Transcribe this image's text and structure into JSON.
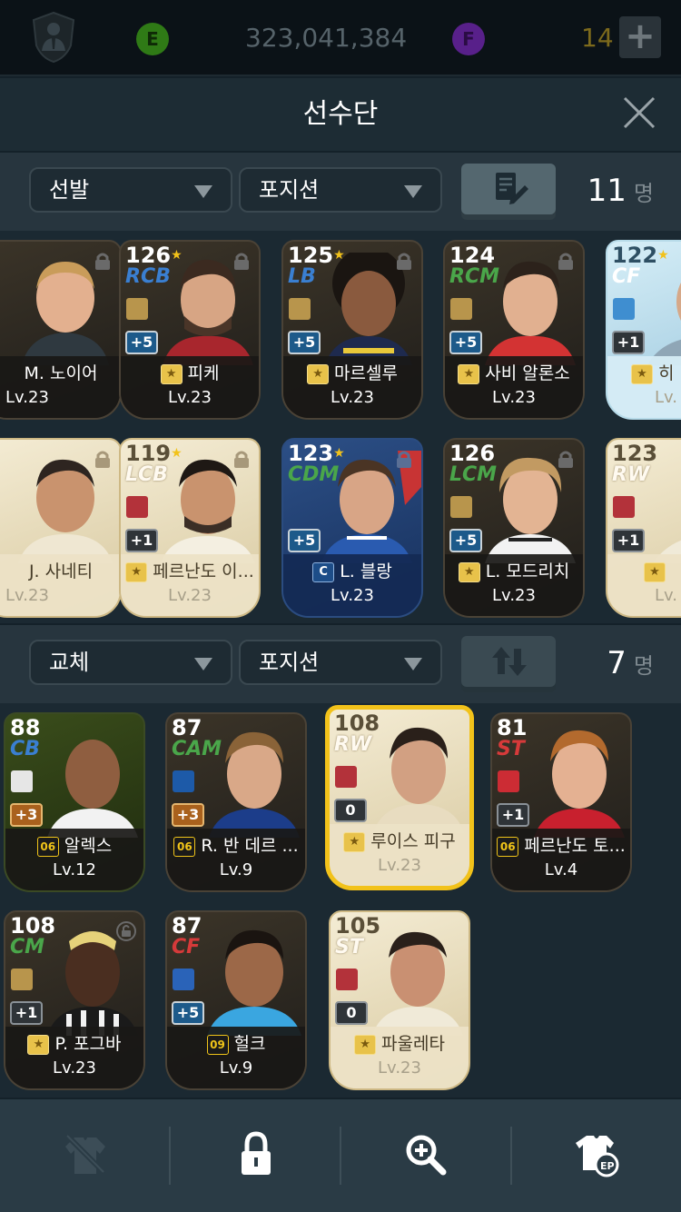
{
  "currency": {
    "coins": "323,041,384",
    "fifa_points": "14",
    "e_label": "E",
    "f_label": "F",
    "plus": "+"
  },
  "header": {
    "title": "선수단"
  },
  "starters": {
    "filter": "선발",
    "position_filter": "포지션",
    "count": "11",
    "unit": "명"
  },
  "subs": {
    "filter": "교체",
    "position_filter": "포지션",
    "count": "7",
    "unit": "명"
  },
  "starter_cards": [
    {
      "ovr": "",
      "pos": "",
      "name": "M. 노이어",
      "lv": "Lv.23",
      "boost": ""
    },
    {
      "ovr": "126",
      "pos": "RCB",
      "name": "피케",
      "lv": "Lv.23",
      "boost": "+5"
    },
    {
      "ovr": "125",
      "pos": "LB",
      "name": "마르셀루",
      "lv": "Lv.23",
      "boost": "+5"
    },
    {
      "ovr": "124",
      "pos": "RCM",
      "name": "사비 알론소",
      "lv": "Lv.23",
      "boost": "+5"
    },
    {
      "ovr": "122",
      "pos": "CF",
      "name": "히",
      "lv": "Lv.",
      "boost": "+1"
    },
    {
      "ovr": "",
      "pos": "",
      "name": "J. 사네티",
      "lv": "Lv.23",
      "boost": ""
    },
    {
      "ovr": "119",
      "pos": "LCB",
      "name": "페르난도 이...",
      "lv": "Lv.23",
      "boost": "+1"
    },
    {
      "ovr": "123",
      "pos": "CDM",
      "name": "L. 블랑",
      "lv": "Lv.23",
      "boost": "+5"
    },
    {
      "ovr": "126",
      "pos": "LCM",
      "name": "L. 모드리치",
      "lv": "Lv.23",
      "boost": "+5"
    },
    {
      "ovr": "123",
      "pos": "RW",
      "name": "",
      "lv": "Lv.",
      "boost": "+1"
    }
  ],
  "sub_cards": [
    {
      "ovr": "88",
      "pos": "CB",
      "name": "알렉스",
      "lv": "Lv.12",
      "boost": "+3",
      "season": "06"
    },
    {
      "ovr": "87",
      "pos": "CAM",
      "name": "R. 반 데르 ...",
      "lv": "Lv.9",
      "boost": "+3",
      "season": "06"
    },
    {
      "ovr": "108",
      "pos": "RW",
      "name": "루이스 피구",
      "lv": "Lv.23",
      "boost": "0",
      "season": ""
    },
    {
      "ovr": "81",
      "pos": "ST",
      "name": "페르난도 토...",
      "lv": "Lv.4",
      "boost": "+1",
      "season": "06"
    },
    {
      "ovr": "108",
      "pos": "CM",
      "name": "P. 포그바",
      "lv": "Lv.23",
      "boost": "+1",
      "season": ""
    },
    {
      "ovr": "87",
      "pos": "CF",
      "name": "헐크",
      "lv": "Lv.9",
      "boost": "+5",
      "season": "09"
    },
    {
      "ovr": "105",
      "pos": "ST",
      "name": "파울레타",
      "lv": "Lv.23",
      "boost": "0",
      "season": ""
    }
  ],
  "toolbar": {
    "icons": [
      "shirt-off-icon",
      "lock-icon",
      "zoom-in-icon",
      "ep-shirt-icon"
    ]
  }
}
